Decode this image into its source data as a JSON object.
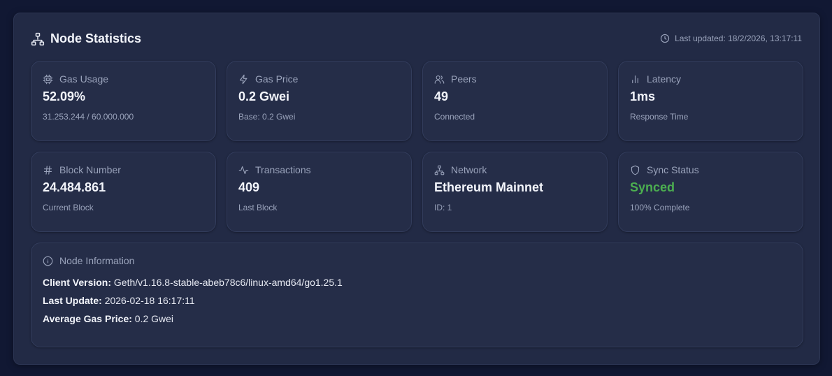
{
  "header": {
    "title": "Node Statistics",
    "title_icon": "network-icon",
    "last_updated_label": "Last updated: 18/2/2026, 13:17:11",
    "clock_icon": "clock-icon"
  },
  "cards": [
    {
      "label": "Gas Usage",
      "icon": "cpu-icon",
      "value": "52.09%",
      "sub": "31.253.244 / 60.000.000"
    },
    {
      "label": "Gas Price",
      "icon": "lightning-icon",
      "value": "0.2 Gwei",
      "sub": "Base: 0.2 Gwei"
    },
    {
      "label": "Peers",
      "icon": "users-icon",
      "value": "49",
      "sub": "Connected"
    },
    {
      "label": "Latency",
      "icon": "bar-chart-icon",
      "value": "1ms",
      "sub": "Response Time"
    },
    {
      "label": "Block Number",
      "icon": "hash-icon",
      "value": "24.484.861",
      "sub": "Current Block"
    },
    {
      "label": "Transactions",
      "icon": "activity-icon",
      "value": "409",
      "sub": "Last Block"
    },
    {
      "label": "Network",
      "icon": "network-icon",
      "value": "Ethereum Mainnet",
      "sub": "ID: 1"
    },
    {
      "label": "Sync Status",
      "icon": "shield-icon",
      "value": "Synced",
      "sub": "100% Complete",
      "value_color": "#4caf50"
    }
  ],
  "node_info": {
    "title": "Node Information",
    "icon": "info-icon",
    "client_version_label": "Client Version:",
    "client_version": "Geth/v1.16.8-stable-abeb78c6/linux-amd64/go1.25.1",
    "last_update_label": "Last Update:",
    "last_update": "2026-02-18 16:17:11",
    "avg_gas_label": "Average Gas Price:",
    "avg_gas": "0.2 Gwei"
  },
  "colors": {
    "background": "#111833",
    "panel": "#222a45",
    "card": "#252d48",
    "muted_text": "#9aa3bb",
    "success": "#4caf50"
  }
}
